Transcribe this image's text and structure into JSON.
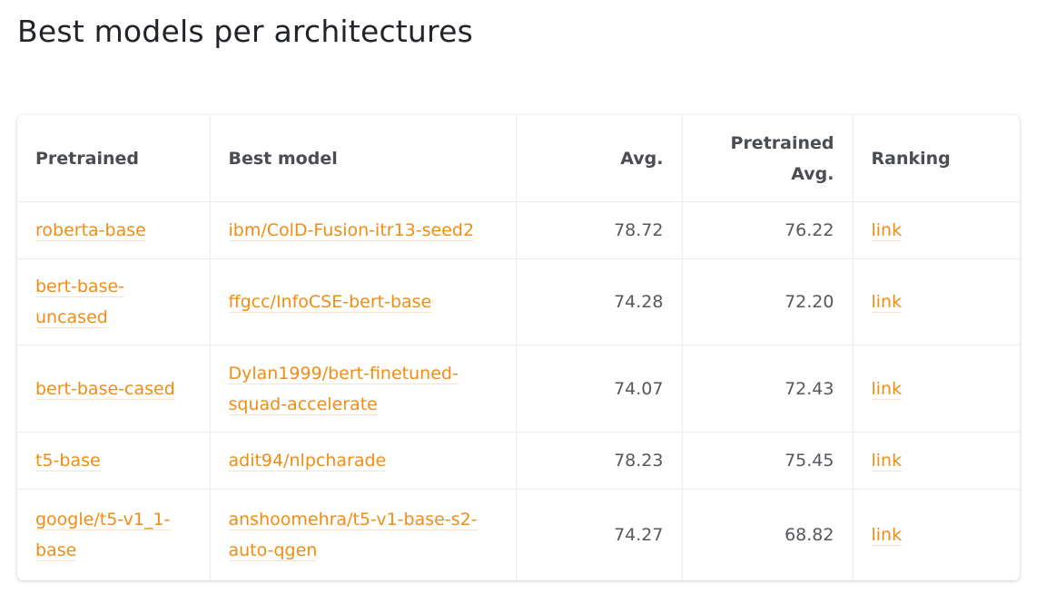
{
  "page": {
    "title": "Best models per architectures"
  },
  "table": {
    "headers": {
      "pretrained": "Pretrained",
      "best_model": "Best model",
      "avg": "Avg.",
      "pretrained_avg_line1": "Pretrained",
      "pretrained_avg_line2": "Avg.",
      "ranking": "Ranking"
    },
    "rows": [
      {
        "pretrained": "roberta-base",
        "best_model": "ibm/ColD-Fusion-itr13-seed2",
        "avg": "78.72",
        "pretrained_avg": "76.22",
        "ranking": "link"
      },
      {
        "pretrained": "bert-base-uncased",
        "best_model": "ffgcc/InfoCSE-bert-base",
        "avg": "74.28",
        "pretrained_avg": "72.20",
        "ranking": "link"
      },
      {
        "pretrained": "bert-base-cased",
        "best_model": "Dylan1999/bert-finetuned-squad-accelerate",
        "avg": "74.07",
        "pretrained_avg": "72.43",
        "ranking": "link"
      },
      {
        "pretrained": "t5-base",
        "best_model": "adit94/nlpcharade",
        "avg": "78.23",
        "pretrained_avg": "75.45",
        "ranking": "link"
      },
      {
        "pretrained": "google/t5-v1_1-base",
        "best_model": "anshoomehra/t5-v1-base-s2-auto-qgen",
        "avg": "74.27",
        "pretrained_avg": "68.82",
        "ranking": "link"
      }
    ]
  },
  "colors": {
    "link": "#f28c13",
    "header_text": "#4a4d52",
    "title_text": "#212529"
  }
}
